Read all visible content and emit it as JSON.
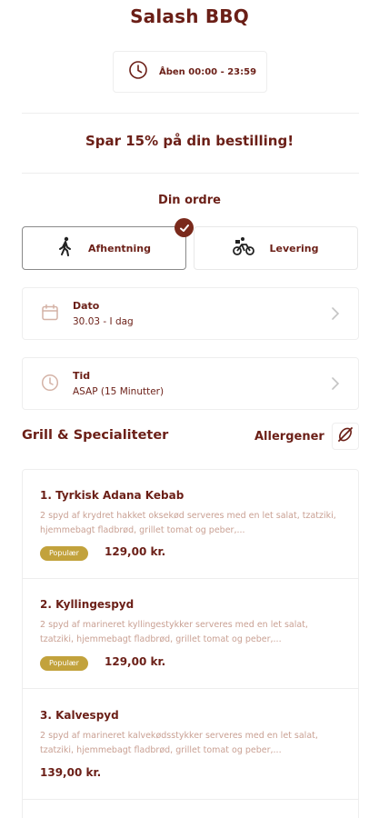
{
  "restaurant": {
    "name": "Salash BBQ"
  },
  "hours": {
    "icon": "clock-icon",
    "text": "Åben 00:00 - 23:59"
  },
  "promo": {
    "text": "Spar 15% på din bestilling!"
  },
  "order": {
    "heading": "Din ordre",
    "options": [
      {
        "label": "Afhentning",
        "icon": "walking-person-icon",
        "selected": true
      },
      {
        "label": "Levering",
        "icon": "bicycle-delivery-icon",
        "selected": false
      }
    ]
  },
  "date": {
    "label": "Dato",
    "value": "30.03 - I dag",
    "icon": "calendar-icon"
  },
  "time": {
    "label": "Tid",
    "value": "ASAP (15 Minutter)",
    "icon": "clock-icon"
  },
  "section": {
    "title": "Grill & Specialiteter",
    "allergen_label": "Allergener",
    "allergen_icon": "no-allergen-icon"
  },
  "items": [
    {
      "name": "1. Tyrkisk Adana Kebab",
      "description": "2 spyd af krydret hakket oksekød serveres med en let salat, tzatziki, hjemmebagt fladbrød, grillet tomat og peber,...",
      "badge": "Populær",
      "price": "129,00 kr."
    },
    {
      "name": "2. Kyllingespyd",
      "description": "2 spyd af marineret kyllingestykker serveres med en let salat, tzatziki, hjemmebagt fladbrød, grillet tomat og peber,...",
      "badge": "Populær",
      "price": "129,00 kr."
    },
    {
      "name": "3. Kalvespyd",
      "description": "2 spyd af marineret kalvekødsstykker serveres med en let salat, tzatziki, hjemmebagt fladbrød, grillet tomat og peber,...",
      "badge": "",
      "price": "139,00 kr."
    }
  ],
  "colors": {
    "primary": "#6b1f17",
    "badge": "#c2a23c",
    "description": "#c9a093",
    "border": "#eeeeee"
  }
}
